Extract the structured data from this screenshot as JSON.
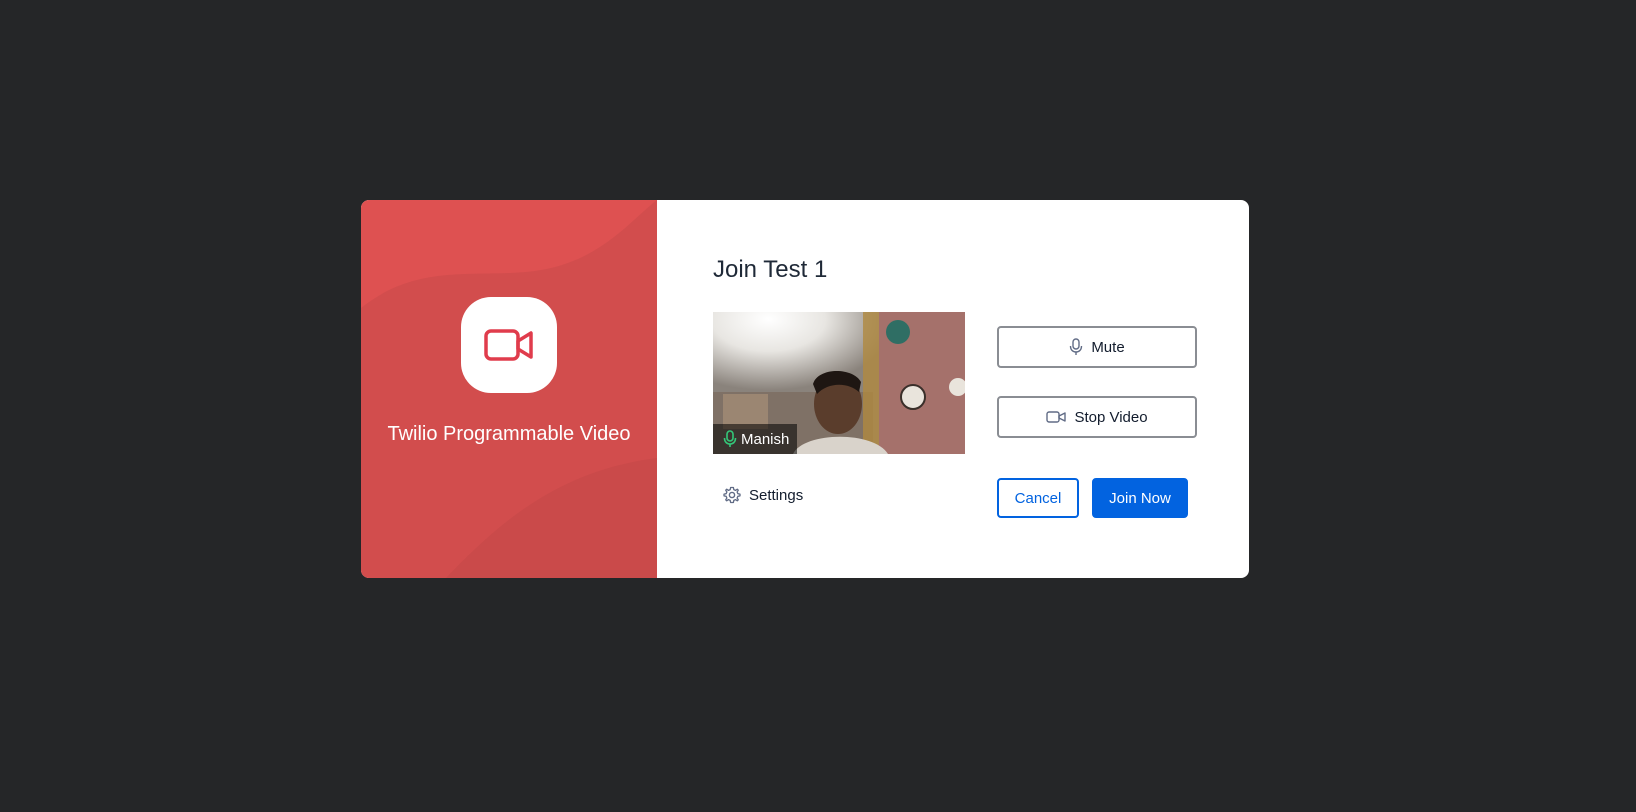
{
  "brand": {
    "title": "Twilio Programmable Video",
    "logo_icon": "video-camera-icon",
    "panel_color": "#de5151"
  },
  "room": {
    "title": "Join Test 1"
  },
  "preview": {
    "participant_name": "Manish",
    "mic_icon": "microphone-icon"
  },
  "controls": {
    "mute_label": "Mute",
    "mute_icon": "microphone-icon",
    "stop_video_label": "Stop Video",
    "stop_video_icon": "video-camera-icon",
    "settings_label": "Settings",
    "settings_icon": "gear-icon",
    "cancel_label": "Cancel",
    "join_label": "Join Now"
  },
  "colors": {
    "accent": "#0263e0",
    "background": "#252628"
  }
}
